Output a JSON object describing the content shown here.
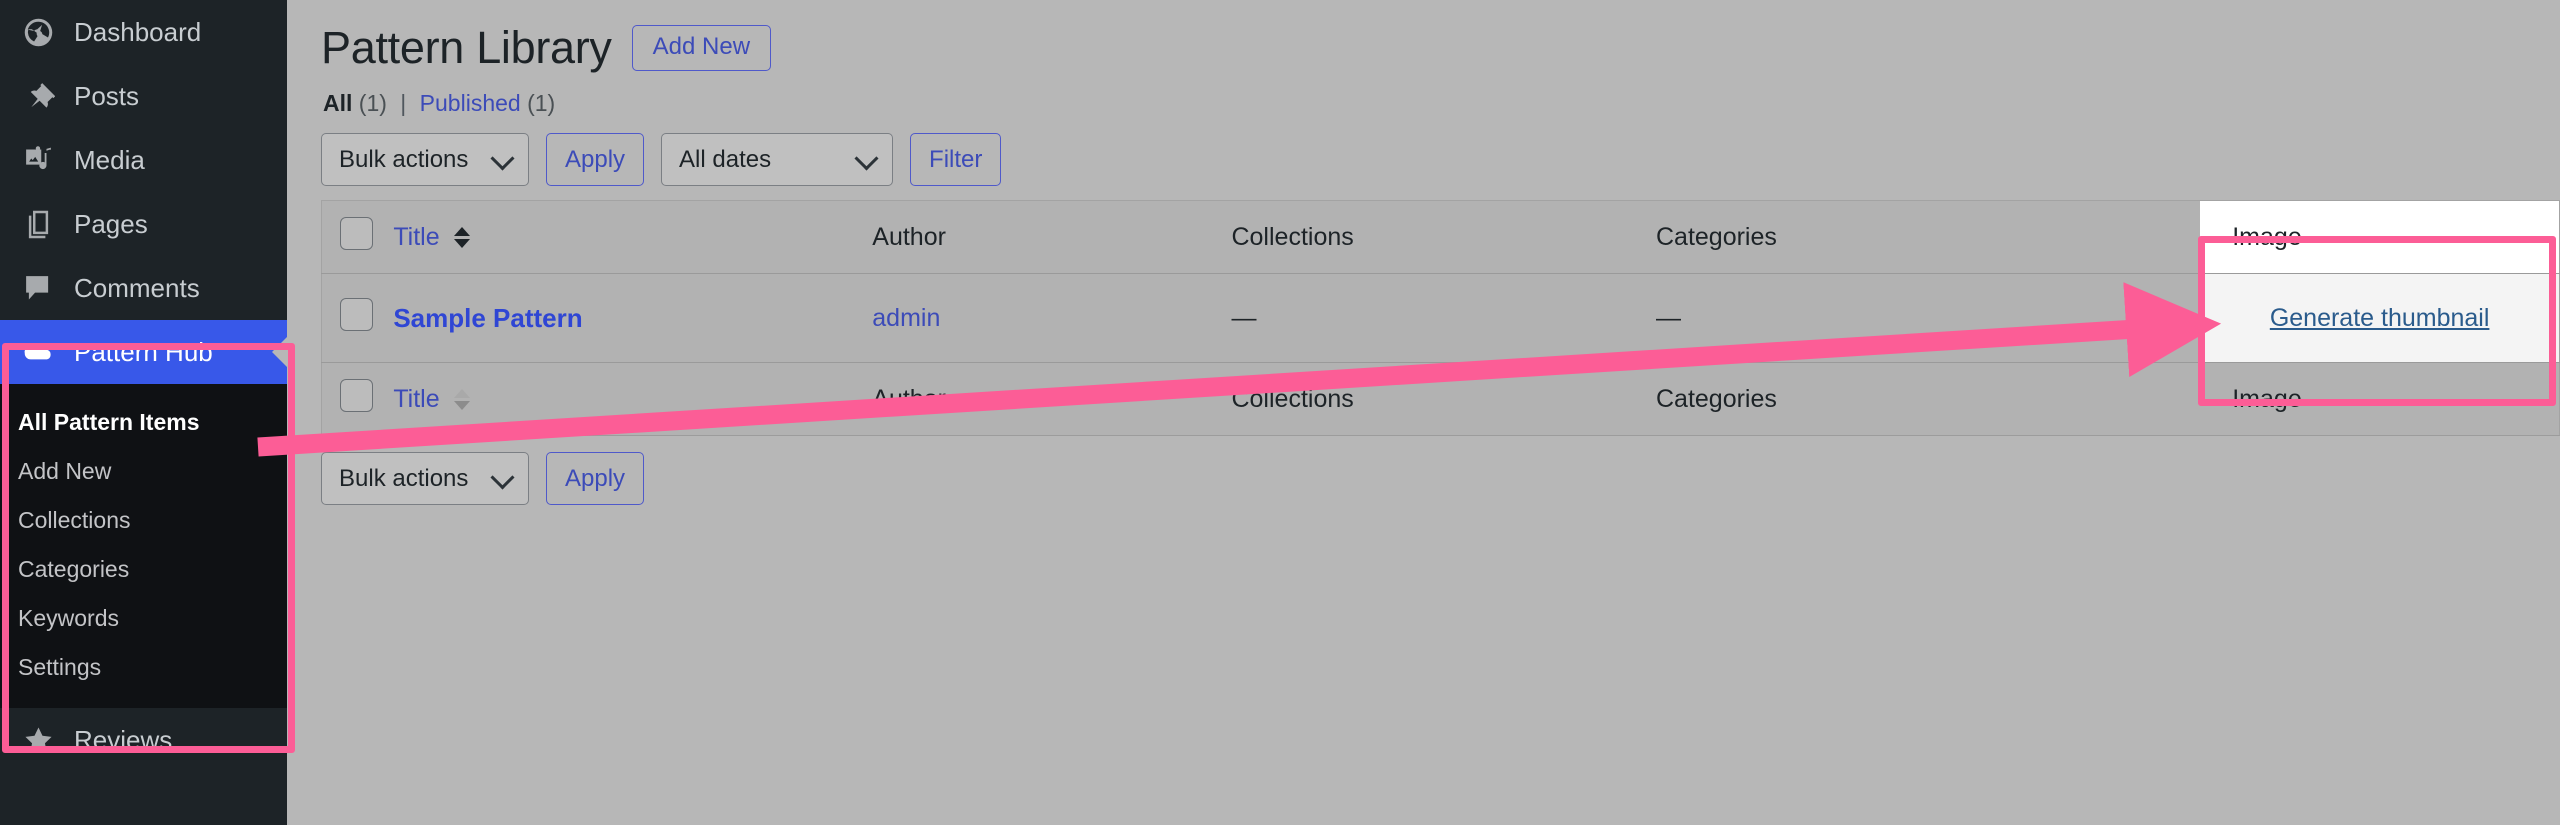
{
  "sidebar": {
    "items": [
      {
        "label": "Dashboard",
        "icon": "dashboard-icon"
      },
      {
        "label": "Posts",
        "icon": "pin-icon"
      },
      {
        "label": "Media",
        "icon": "media-icon"
      },
      {
        "label": "Pages",
        "icon": "pages-icon"
      },
      {
        "label": "Comments",
        "icon": "comments-icon"
      },
      {
        "label": "Pattern Hub",
        "icon": "cloud-icon",
        "current": true
      },
      {
        "label": "Reviews",
        "icon": "star-icon"
      }
    ],
    "submenu": [
      {
        "label": "All Pattern Items",
        "current": true
      },
      {
        "label": "Add New"
      },
      {
        "label": "Collections"
      },
      {
        "label": "Categories"
      },
      {
        "label": "Keywords"
      },
      {
        "label": "Settings"
      }
    ]
  },
  "header": {
    "title": "Pattern Library",
    "add_new_label": "Add New"
  },
  "status_links": {
    "all_label": "All",
    "all_count": "(1)",
    "separator": "|",
    "published_label": "Published",
    "published_count": "(1)"
  },
  "tablenav_top": {
    "bulk_actions": "Bulk actions",
    "apply_label": "Apply",
    "all_dates": "All dates",
    "filter_label": "Filter"
  },
  "tablenav_bottom": {
    "bulk_actions": "Bulk actions",
    "apply_label": "Apply"
  },
  "table": {
    "columns": {
      "title": "Title",
      "author": "Author",
      "collections": "Collections",
      "categories": "Categories",
      "image": "Image"
    },
    "rows": [
      {
        "title": "Sample Pattern",
        "author": "admin",
        "collections": "—",
        "categories": "—",
        "image_action": "Generate thumbnail"
      }
    ]
  },
  "annotations": {
    "highlight_color": "#fc5d96",
    "sidebar_box": "pattern-hub-menu-highlight",
    "image_column_box": "image-column-highlight",
    "arrow": "arrow-from-sidebar-to-image-column"
  },
  "colors": {
    "admin_blue": "#3858e9",
    "link_blue": "#3c4bb8",
    "sidebar_bg": "#1d2327",
    "page_bg": "#b7b7b7"
  }
}
